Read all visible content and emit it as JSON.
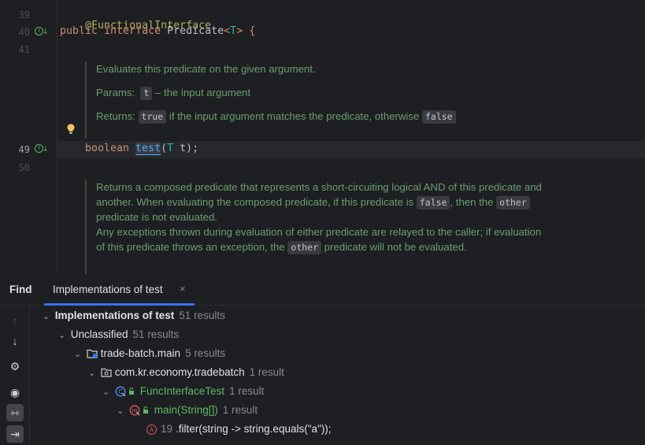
{
  "editor": {
    "lines": {
      "l39": "39",
      "l40": "40",
      "l41": "41",
      "l49": "49",
      "l50": "50"
    },
    "code": {
      "annotation": "@FunctionalInterface",
      "decl_kw": "public interface ",
      "decl_name": "Predicate",
      "decl_lt": "<",
      "decl_tparam": "T",
      "decl_rest": "> {",
      "method_type": "boolean ",
      "method_name": "test",
      "method_paren": "(",
      "method_ptype": "T",
      "method_rest": " t);"
    },
    "doc1": {
      "summary": "Evaluates this predicate on the given argument.",
      "params_label": "Params:",
      "params_code": "t",
      "params_text": " – the input argument",
      "returns_label": "Returns:",
      "returns_code": "true",
      "returns_text": " if the input argument matches the predicate, otherwise ",
      "returns_code2": "false"
    },
    "doc2": {
      "line1": "Returns a composed predicate that represents a short-circuiting logical AND of this predicate and",
      "line2a": "another. When evaluating the composed predicate, if this predicate is ",
      "line2_code": "false",
      "line2b": ", then the ",
      "line2_code2": "other",
      "line3": "predicate is not evaluated.",
      "line4": "Any exceptions thrown during evaluation of either predicate are relayed to the caller; if evaluation",
      "line5a": "of this predicate throws an exception, the ",
      "line5_code": "other",
      "line5b": " predicate will not be evaluated."
    }
  },
  "find": {
    "title": "Find",
    "tab_label": "Implementations of test",
    "tab_close": "×"
  },
  "toolbar": {
    "up": "↑",
    "down": "↓",
    "settings": "⚙",
    "preview": "◉",
    "expand": "⇿",
    "collapse": "⇥"
  },
  "tree": {
    "root": {
      "label": "Implementations of test",
      "count": "51 results"
    },
    "unclassified": {
      "label": "Unclassified",
      "count": "51 results"
    },
    "module": {
      "label": "trade-batch.main",
      "count": "5 results"
    },
    "package": {
      "label": "com.kr.economy.tradebatch",
      "count": "1 result"
    },
    "klass": {
      "label": "FuncInterfaceTest",
      "count": "1 result"
    },
    "method": {
      "label": "main(String[])",
      "count": "1 result"
    },
    "usage": {
      "line": "19",
      "code_a": ".filter(string -> string.equals(",
      "code_str": "\"a\"",
      "code_b": "));"
    }
  },
  "colors": {
    "accent": "#3574f0",
    "doc_text": "#6a9e72",
    "keyword": "#cf8e6d",
    "annotation": "#b3ae60",
    "type_param": "#16baac",
    "method": "#56a8f5",
    "class_green": "#5fb865",
    "lambda_red": "#db5c5c"
  }
}
